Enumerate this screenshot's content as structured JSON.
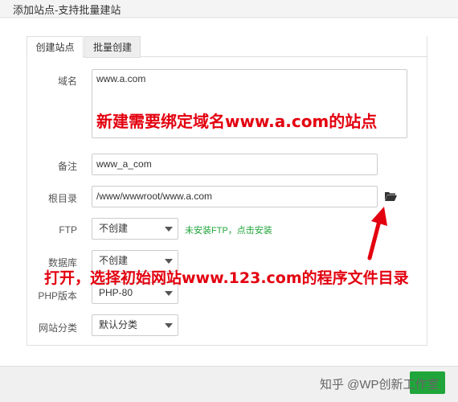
{
  "window": {
    "title": "添加站点-支持批量建站"
  },
  "tabs": [
    {
      "label": "创建站点",
      "active": true
    },
    {
      "label": "批量创建",
      "active": false
    }
  ],
  "form": {
    "domain": {
      "label": "域名",
      "value": "www.a.com"
    },
    "remark": {
      "label": "备注",
      "value": "www_a_com"
    },
    "root": {
      "label": "根目录",
      "value": "/www/wwwroot/www.a.com"
    },
    "ftp": {
      "label": "FTP",
      "value": "不创建",
      "hint": "未安装FTP，点击安装"
    },
    "database": {
      "label": "数据库",
      "value": "不创建"
    },
    "php": {
      "label": "PHP版本",
      "value": "PHP-80"
    },
    "category": {
      "label": "网站分类",
      "value": "默认分类"
    }
  },
  "annotations": {
    "line1": "新建需要绑定域名www.a.com的站点",
    "line2": "打开，选择初始网站www.123.com的程序文件目录"
  },
  "watermark": "知乎 @WP创新工作室",
  "colors": {
    "accent": "#20a53a",
    "annotation": "#e3000f"
  }
}
